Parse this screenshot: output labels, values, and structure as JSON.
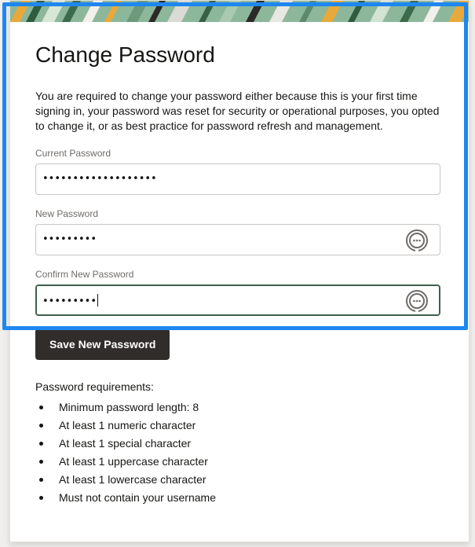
{
  "dialog": {
    "title": "Change Password",
    "intro": "You are required to change your password either because this is your first time signing in, your password was reset for security or operational purposes, you opted to change it, or as best practice for password refresh and management."
  },
  "fields": {
    "current": {
      "label": "Current Password",
      "value": "•••••••••••••••••••"
    },
    "new": {
      "label": "New Password",
      "value": "•••••••••",
      "reveal_icon": "reveal-password-icon"
    },
    "confirm": {
      "label": "Confirm New Password",
      "value": "•••••••••",
      "reveal_icon": "reveal-password-icon",
      "focused": true
    }
  },
  "actions": {
    "save_label": "Save New Password"
  },
  "requirements": {
    "title": "Password requirements:",
    "items": [
      "Minimum password length: 8",
      "At least 1 numeric character",
      "At least 1 special character",
      "At least 1 uppercase character",
      "At least 1 lowercase character",
      "Must not contain your username"
    ]
  },
  "colors": {
    "button_bg": "#312d2a",
    "focus_border": "#3f5e4b",
    "highlight_frame": "#1e87f0",
    "label_text": "#6f6c69"
  }
}
